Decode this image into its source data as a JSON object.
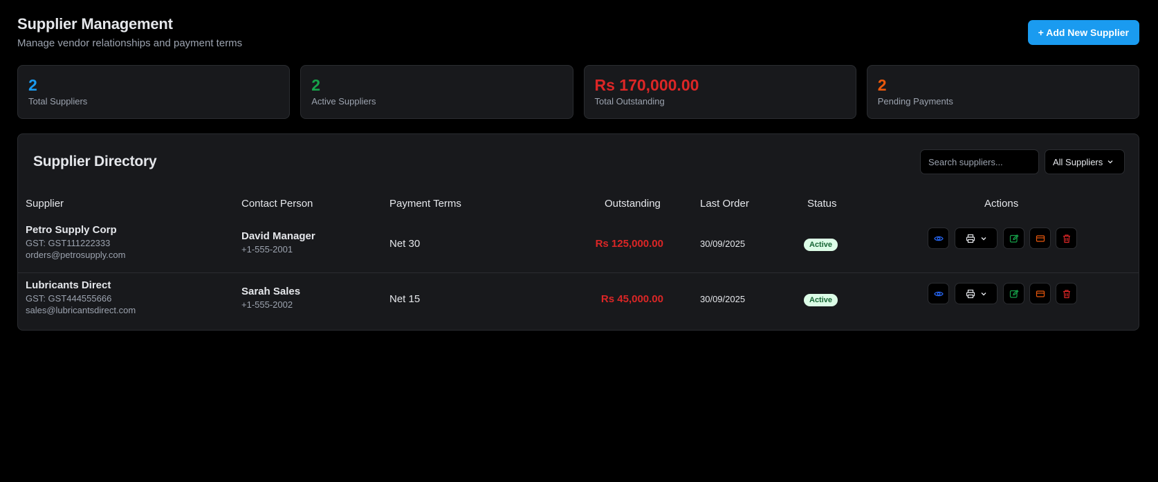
{
  "header": {
    "title": "Supplier Management",
    "subtitle": "Manage vendor relationships and payment terms",
    "add_button": "+ Add New Supplier"
  },
  "stats": [
    {
      "value": "2",
      "label": "Total Suppliers",
      "color": "#1a9bf0"
    },
    {
      "value": "2",
      "label": "Active Suppliers",
      "color": "#16a34a"
    },
    {
      "value": "Rs 170,000.00",
      "label": "Total Outstanding",
      "color": "#dc2626"
    },
    {
      "value": "2",
      "label": "Pending Payments",
      "color": "#ea580c"
    }
  ],
  "directory": {
    "title": "Supplier Directory",
    "search_placeholder": "Search suppliers...",
    "filter_value": "All Suppliers",
    "columns": [
      "Supplier",
      "Contact Person",
      "Payment Terms",
      "Outstanding",
      "Last Order",
      "Status",
      "Actions"
    ],
    "rows": [
      {
        "name": "Petro Supply Corp",
        "gst": "GST: GST111222333",
        "email": "orders@petrosupply.com",
        "contact": "David Manager",
        "phone": "+1-555-2001",
        "terms": "Net 30",
        "outstanding": "Rs 125,000.00",
        "last_order": "30/09/2025",
        "status": "Active"
      },
      {
        "name": "Lubricants Direct",
        "gst": "GST: GST444555666",
        "email": "sales@lubricantsdirect.com",
        "contact": "Sarah Sales",
        "phone": "+1-555-2002",
        "terms": "Net 15",
        "outstanding": "Rs 45,000.00",
        "last_order": "30/09/2025",
        "status": "Active"
      }
    ]
  },
  "colors": {
    "accent": "#1a9bf0",
    "danger": "#dc2626",
    "success": "#16a34a",
    "warning": "#ea580c",
    "view_icon": "#2563eb"
  },
  "icons": [
    "eye-icon",
    "printer-icon",
    "chevron-down-icon",
    "edit-icon",
    "credit-card-icon",
    "trash-icon"
  ]
}
